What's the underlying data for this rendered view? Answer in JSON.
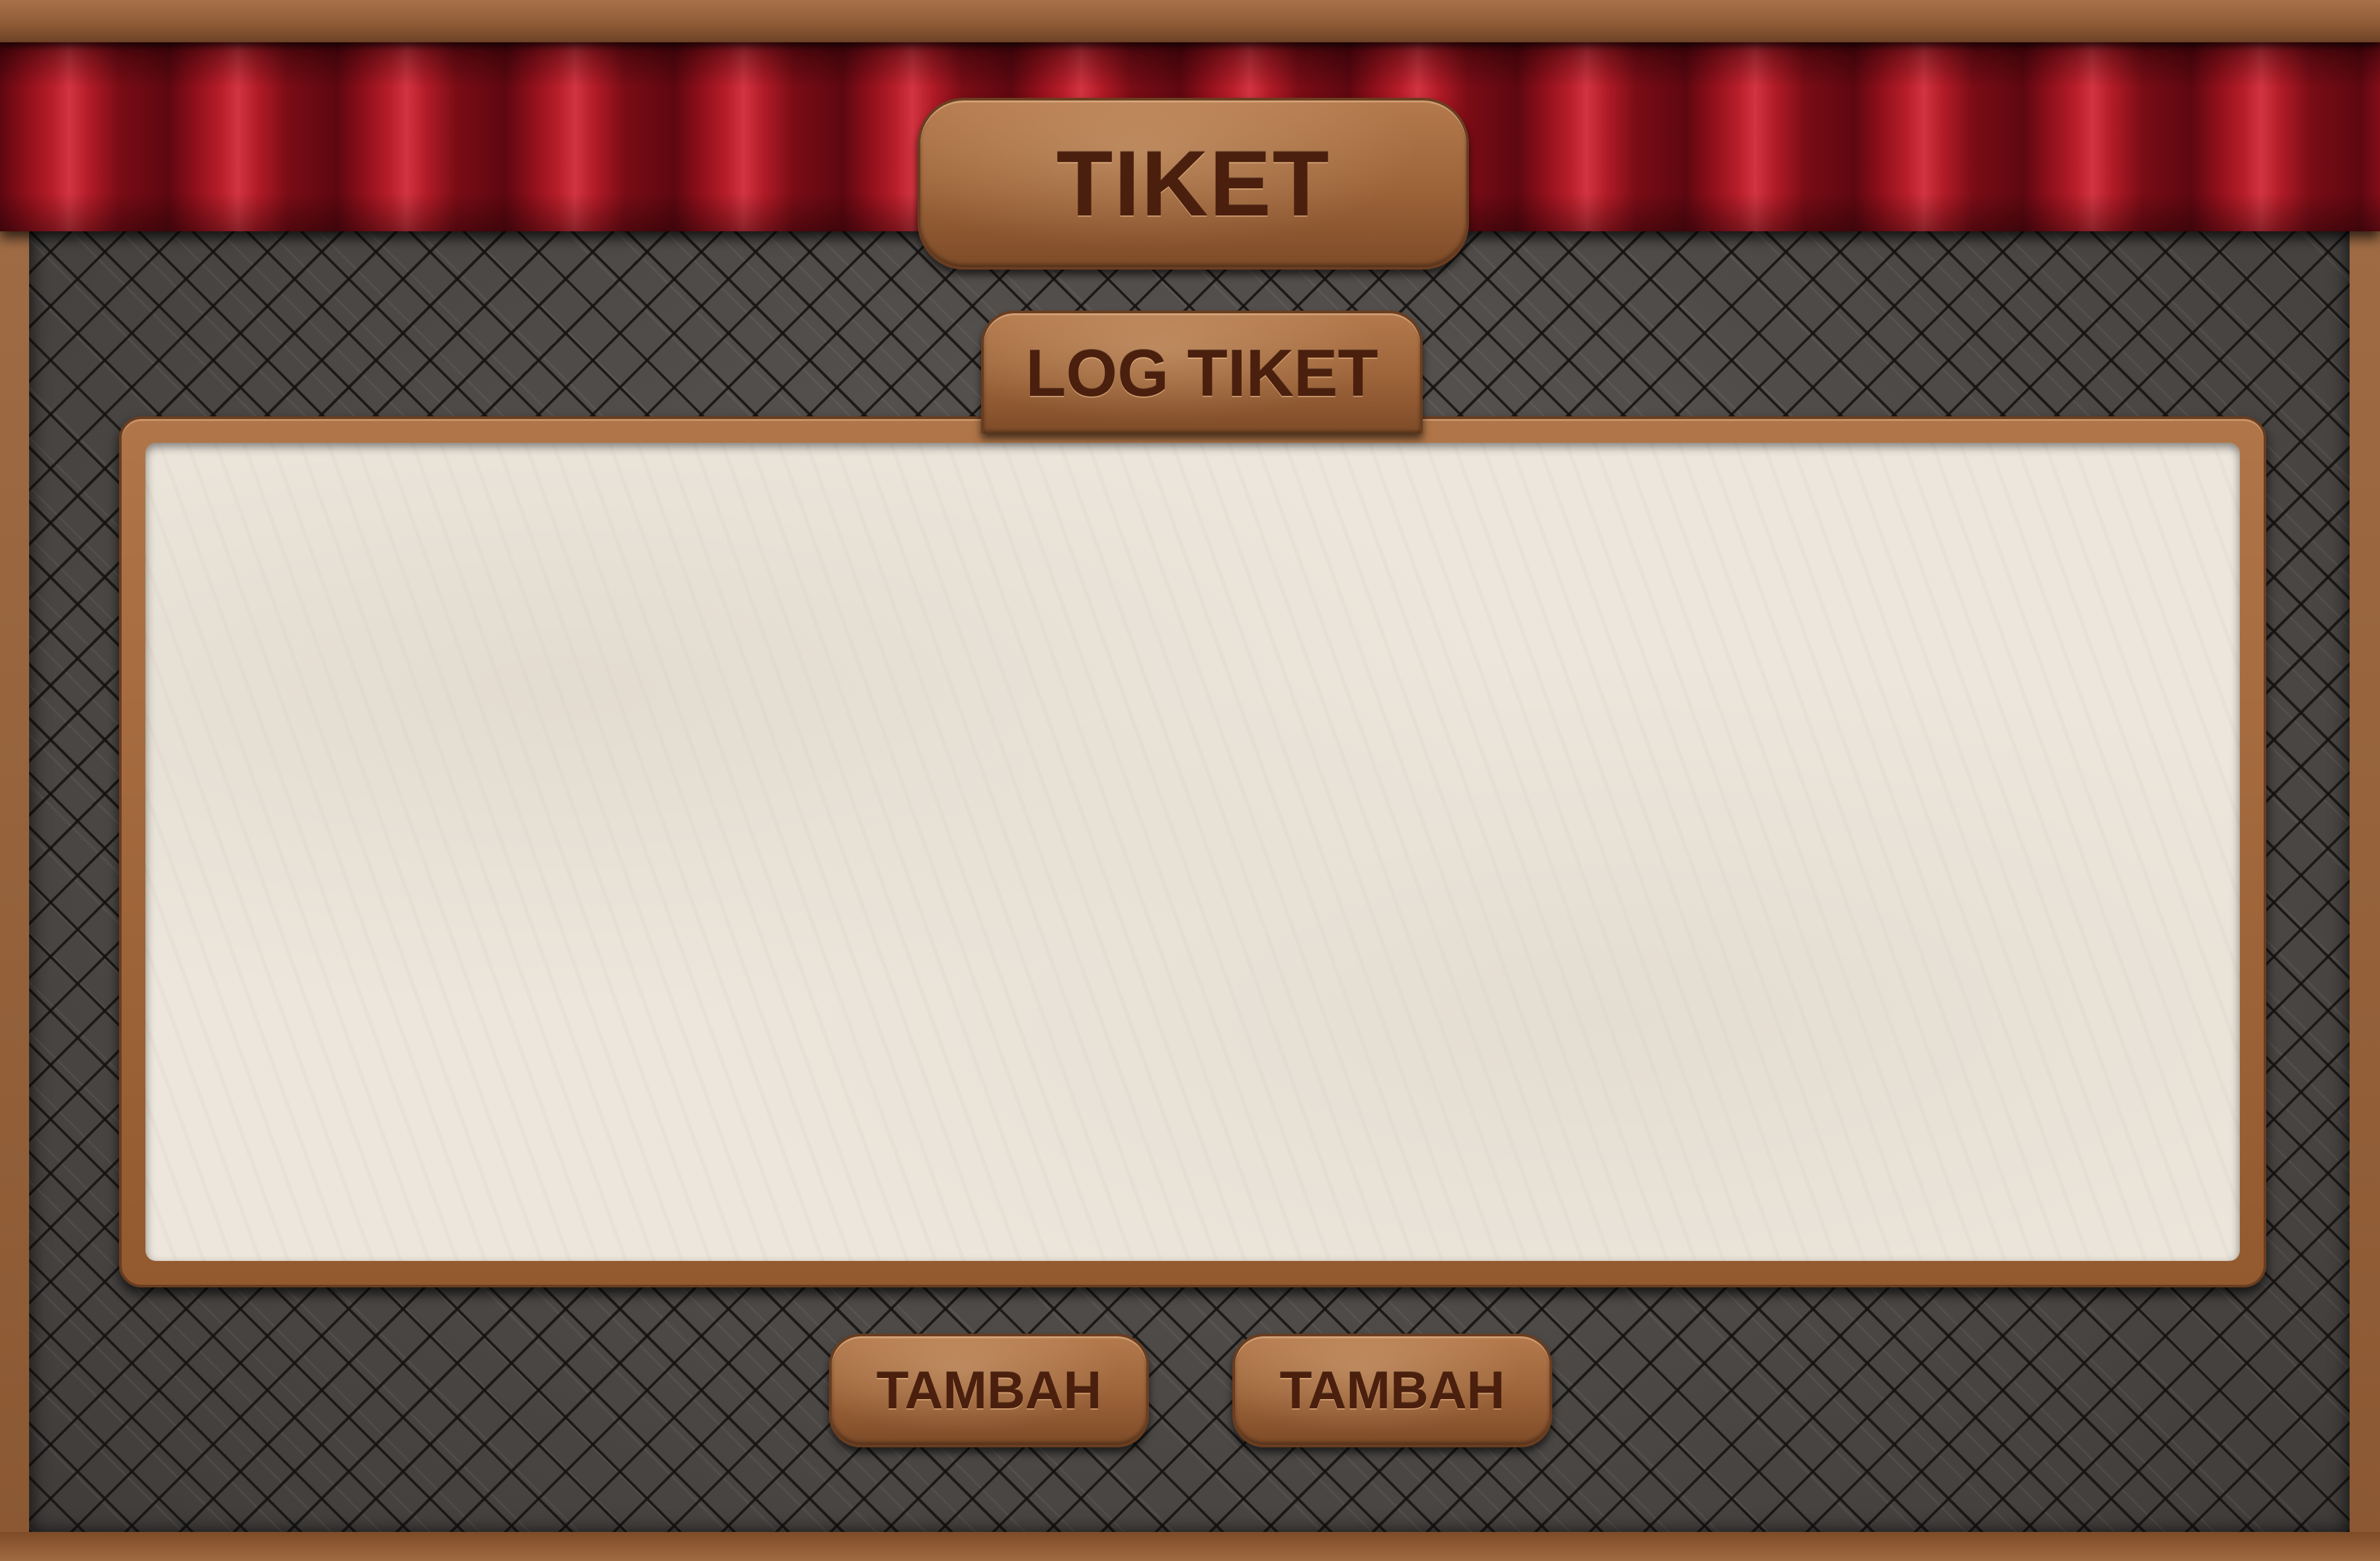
{
  "header": {
    "title": "TIKET"
  },
  "log_panel": {
    "tab_label": "LOG TIKET",
    "entries": []
  },
  "actions": {
    "button_1_label": "TAMBAH",
    "button_2_label": "TAMBAH"
  },
  "colors": {
    "curtain": "#b81e2a",
    "leather": "#9c6339",
    "quilt": "#4e4b49",
    "paper": "#ece6dc",
    "text": "#4a1f0d"
  }
}
